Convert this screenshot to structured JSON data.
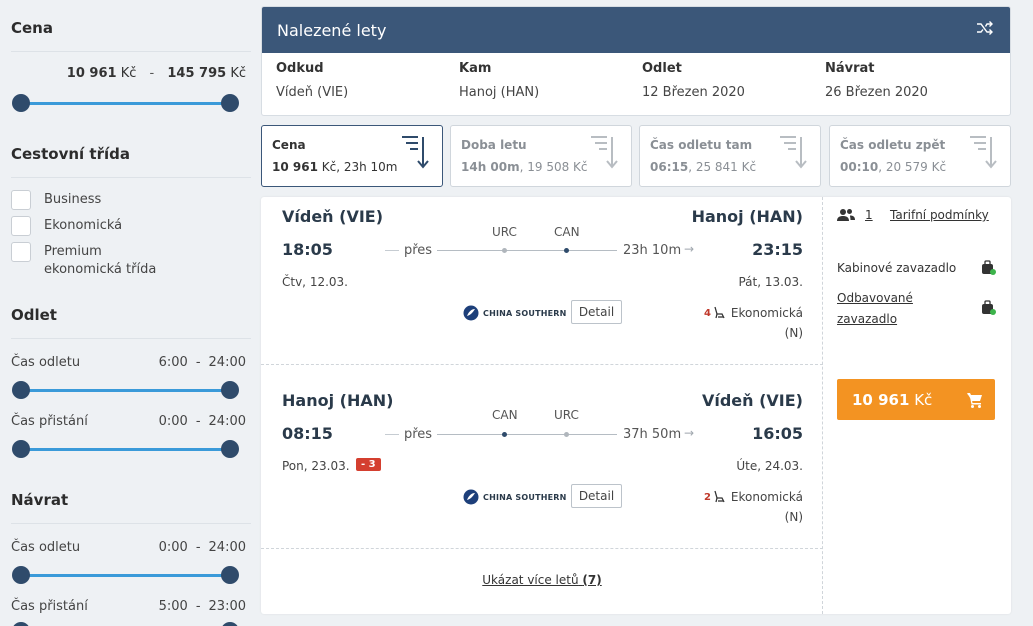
{
  "sidebar": {
    "price": {
      "title": "Cena",
      "min": "10 961",
      "max": "145 795",
      "currency": "Kč",
      "separator": "-"
    },
    "travel_class": {
      "title": "Cestovní třída",
      "options": [
        {
          "label": "Business"
        },
        {
          "label": "Ekonomická"
        },
        {
          "label": "Premium ekonomická třída"
        }
      ]
    },
    "departure": {
      "title": "Odlet",
      "rows": [
        {
          "label": "Čas odletu",
          "from": "6:00",
          "sep": "-",
          "to": "24:00"
        },
        {
          "label": "Čas přistání",
          "from": "0:00",
          "sep": "-",
          "to": "24:00"
        }
      ]
    },
    "return": {
      "title": "Návrat",
      "rows": [
        {
          "label": "Čas odletu",
          "from": "0:00",
          "sep": "-",
          "to": "24:00"
        },
        {
          "label": "Čas přistání",
          "from": "5:00",
          "sep": "-",
          "to": "23:00"
        }
      ]
    }
  },
  "header": {
    "title": "Nalezené lety",
    "columns": [
      {
        "label": "Odkud",
        "value": "Vídeň (VIE)"
      },
      {
        "label": "Kam",
        "value": "Hanoj (HAN)"
      },
      {
        "label": "Odlet",
        "value": "12 Březen 2020"
      },
      {
        "label": "Návrat",
        "value": "26 Březen 2020"
      }
    ]
  },
  "sort_tabs": [
    {
      "label": "Cena",
      "bold": "10 961",
      "rest": " Kč, 23h 10m",
      "active": true
    },
    {
      "label": "Doba letu",
      "bold": "14h 00m",
      "rest": ", 19 508 Kč",
      "active": false
    },
    {
      "label": "Čas odletu tam",
      "bold": "06:15",
      "rest": ", 25 841 Kč",
      "active": false
    },
    {
      "label": "Čas odletu zpět",
      "bold": "00:10",
      "rest": ", 20 579 Kč",
      "active": false
    }
  ],
  "result": {
    "outbound": {
      "from_city": "Vídeň (VIE)",
      "to_city": "Hanoj (HAN)",
      "dep_time": "18:05",
      "arr_time": "23:15",
      "via_label": "přes",
      "stops": [
        "URC",
        "CAN"
      ],
      "duration": "23h 10m",
      "dep_date": "Čtv, 12.03.",
      "arr_date": "Pát, 13.03.",
      "airline": "CHINA SOUTHERN",
      "detail_label": "Detail",
      "seats": "4",
      "cabin_line1": "Ekonomická",
      "cabin_line2": "(N)"
    },
    "inbound": {
      "from_city": "Hanoj (HAN)",
      "to_city": "Vídeň (VIE)",
      "dep_time": "08:15",
      "arr_time": "16:05",
      "via_label": "přes",
      "stops": [
        "CAN",
        "URC"
      ],
      "duration": "37h 50m",
      "dep_date": "Pon, 23.03.",
      "day_badge": "- 3",
      "arr_date": "Úte, 24.03.",
      "airline": "CHINA SOUTHERN",
      "detail_label": "Detail",
      "seats": "2",
      "cabin_line1": "Ekonomická",
      "cabin_line2": "(N)"
    },
    "more_link_text": "Ukázat více letů",
    "more_link_count": "(7)",
    "side": {
      "passengers": "1",
      "tariff_link": "Tarifní podmínky",
      "cabin_bag": "Kabinové zavazadlo",
      "checked_bag_line1": "Odbavované",
      "checked_bag_line2": "zavazadlo",
      "price": "10 961",
      "currency": "Kč"
    }
  },
  "colors": {
    "header_bg": "#3b5779",
    "slider_track": "#3a9ad9",
    "slider_knob": "#2f4b6b",
    "buy_button": "#f39322",
    "badge_red": "#d43f2f"
  }
}
